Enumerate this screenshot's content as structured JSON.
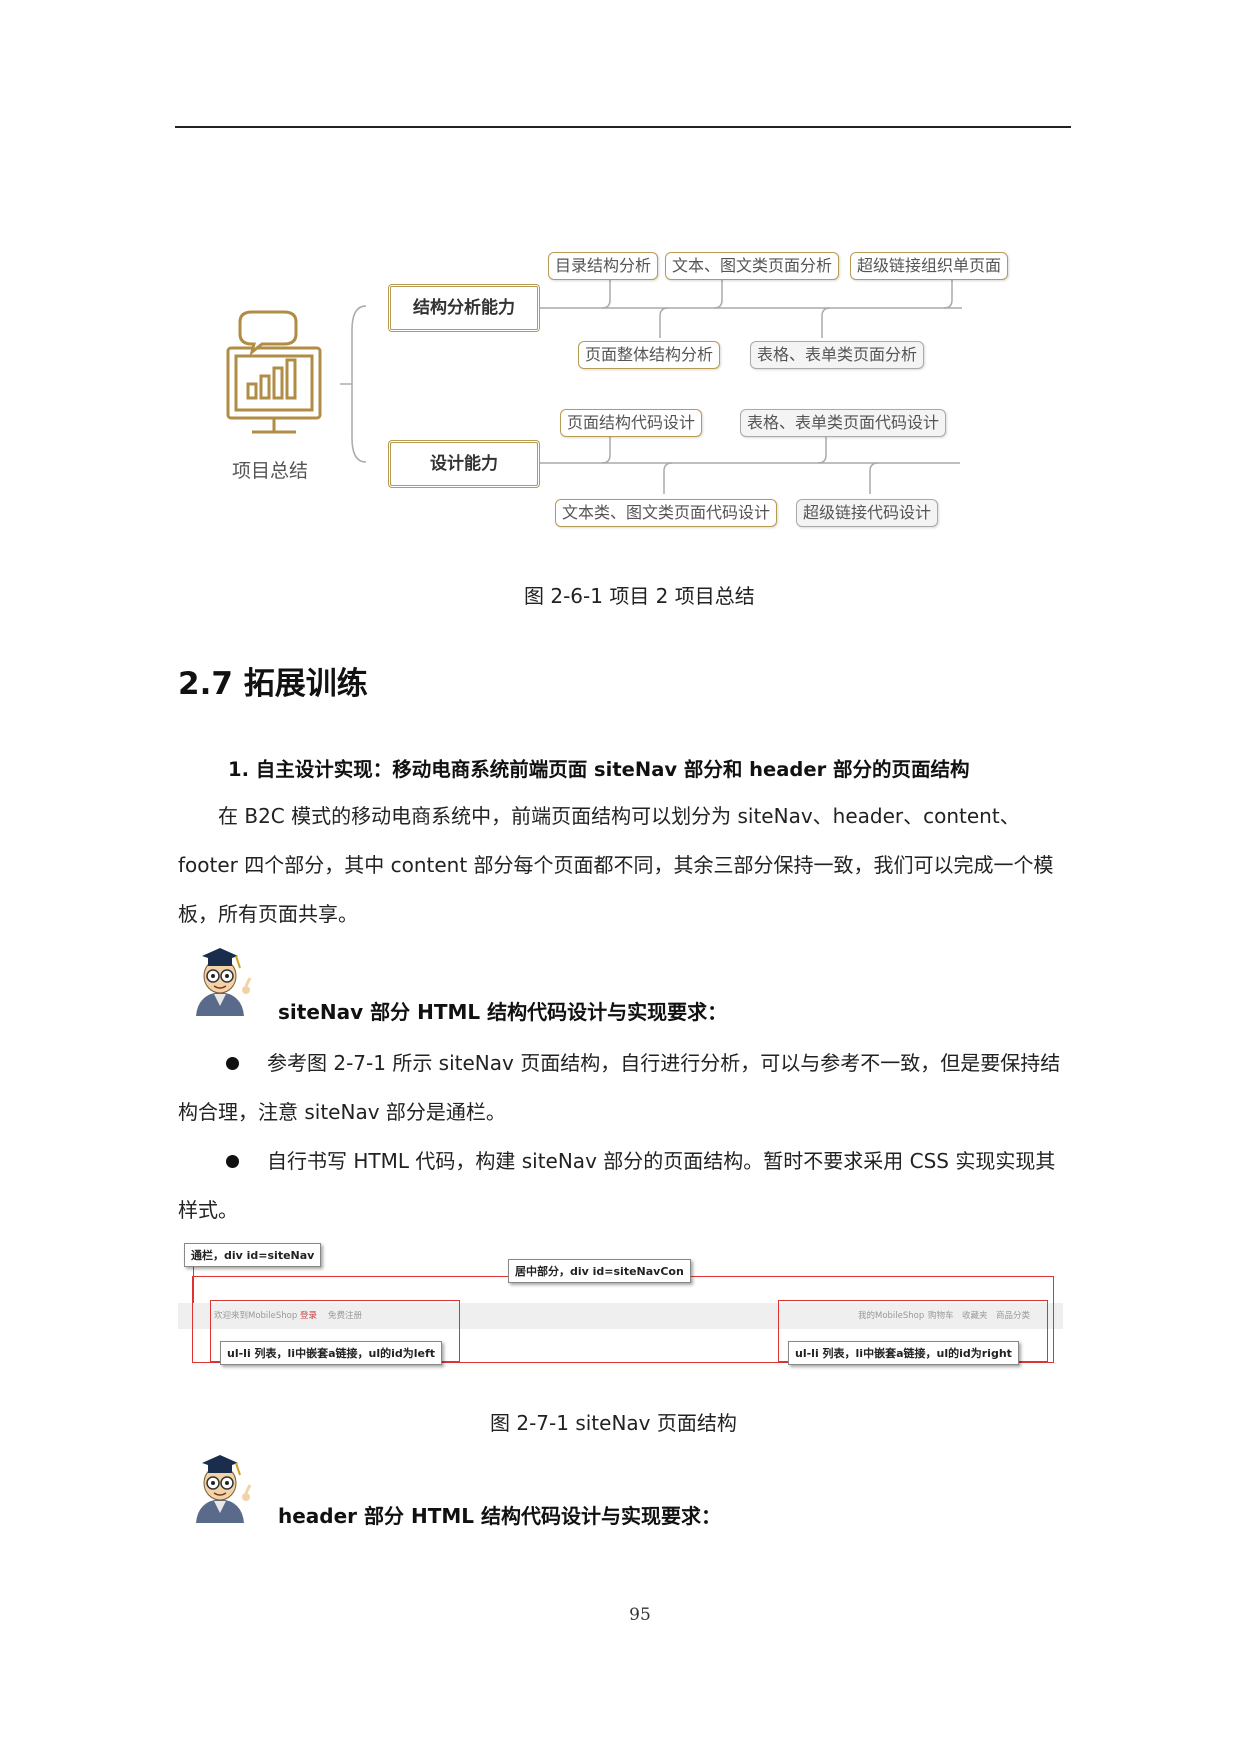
{
  "mindmap": {
    "root_label": "项目总结",
    "branch1": {
      "label": "结构分析能力",
      "top_items": [
        "目录结构分析",
        "文本、图文类页面分析",
        "超级链接组织单页面"
      ],
      "bottom_items": [
        "页面整体结构分析",
        "表格、表单类页面分析"
      ]
    },
    "branch2": {
      "label": "设计能力",
      "top_items": [
        "页面结构代码设计",
        "表格、表单类页面代码设计"
      ],
      "bottom_items": [
        "文本类、图文类页面代码设计",
        "超级链接代码设计"
      ]
    },
    "accent_color": "#b79b55"
  },
  "figure1_caption": "图 2-6-1  项目 2 项目总结",
  "section_title": "2.7 拓展训练",
  "subheading": "1.   自主设计实现：移动电商系统前端页面 siteNav 部分和 header 部分的页面结构",
  "paragraph1": "在 B2C 模式的移动电商系统中，前端页面结构可以划分为 siteNav、header、content、footer 四个部分，其中 content 部分每个页面都不同，其余三部分保持一致，我们可以完成一个模板，所有页面共享。",
  "req1_title": "siteNav 部分 HTML 结构代码设计与实现要求：",
  "bullet1": "参考图 2-7-1 所示 siteNav 页面结构，自行进行分析，可以与参考不一致，但是要保持结构合理，注意 siteNav 部分是通栏。",
  "bullet2": "自行书写 HTML 代码，构建 siteNav 部分的页面结构。暂时不要求采用 CSS 实现实现其样式。",
  "sitenav_figure": {
    "label_full": "通栏，div id=siteNav",
    "label_center": "居中部分，div id=siteNavCon",
    "label_left": "ul-li 列表，li中嵌套a链接，ul的id为left",
    "label_right": "ul-li 列表，li中嵌套a链接，ul的id为right",
    "left_links": [
      "欢迎来到MobileShop",
      "登录",
      "免费注册"
    ],
    "right_links": [
      "我的MobileShop",
      "购物车",
      "收藏夹",
      "商品分类"
    ]
  },
  "figure2_caption": "图 2-7-1    siteNav 页面结构",
  "req2_title": "header 部分 HTML 结构代码设计与实现要求：",
  "page_number": "95"
}
